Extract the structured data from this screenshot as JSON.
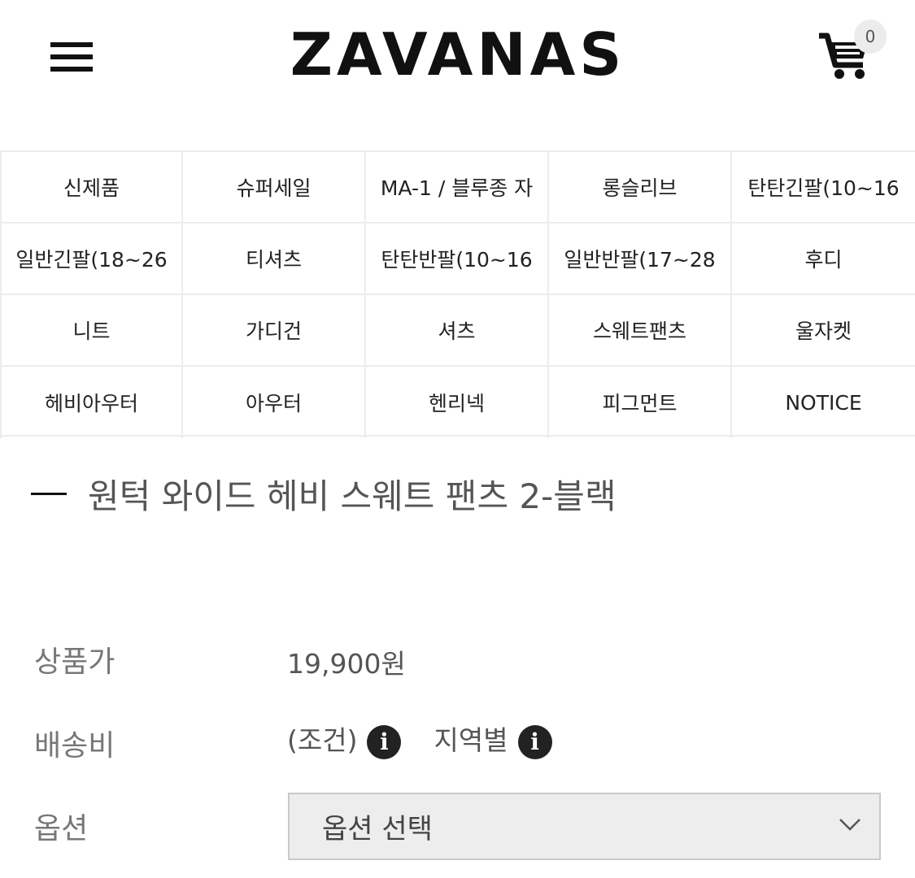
{
  "header": {
    "logo": "ZAVANAS",
    "cart_count": "0",
    "icons": {
      "menu": "hamburger-menu-icon",
      "cart": "shopping-cart-icon"
    }
  },
  "categories": [
    "신제품",
    "슈퍼세일",
    "MA-1 / 블루종 자",
    "롱슬리브",
    "탄탄긴팔(10~16",
    "일반긴팔(18~26",
    "티셔츠",
    "탄탄반팔(10~16",
    "일반반팔(17~28",
    "후디",
    "니트",
    "가디건",
    "셔츠",
    "스웨트팬츠",
    "울자켓",
    "헤비아우터",
    "아우터",
    "헨리넥",
    "피그먼트",
    "NOTICE"
  ],
  "product": {
    "title": "원턱 와이드 헤비 스웨트 팬츠 2-블랙",
    "price_label": "상품가",
    "price_value": "19,900원",
    "shipping_label": "배송비",
    "shipping_condition": "(조건)",
    "shipping_region": "지역별",
    "option_label": "옵션",
    "option_select": "옵션 선택"
  },
  "colors": {
    "text_dark": "#111111",
    "grid_line": "#ececec",
    "select_bg": "#ededed"
  }
}
